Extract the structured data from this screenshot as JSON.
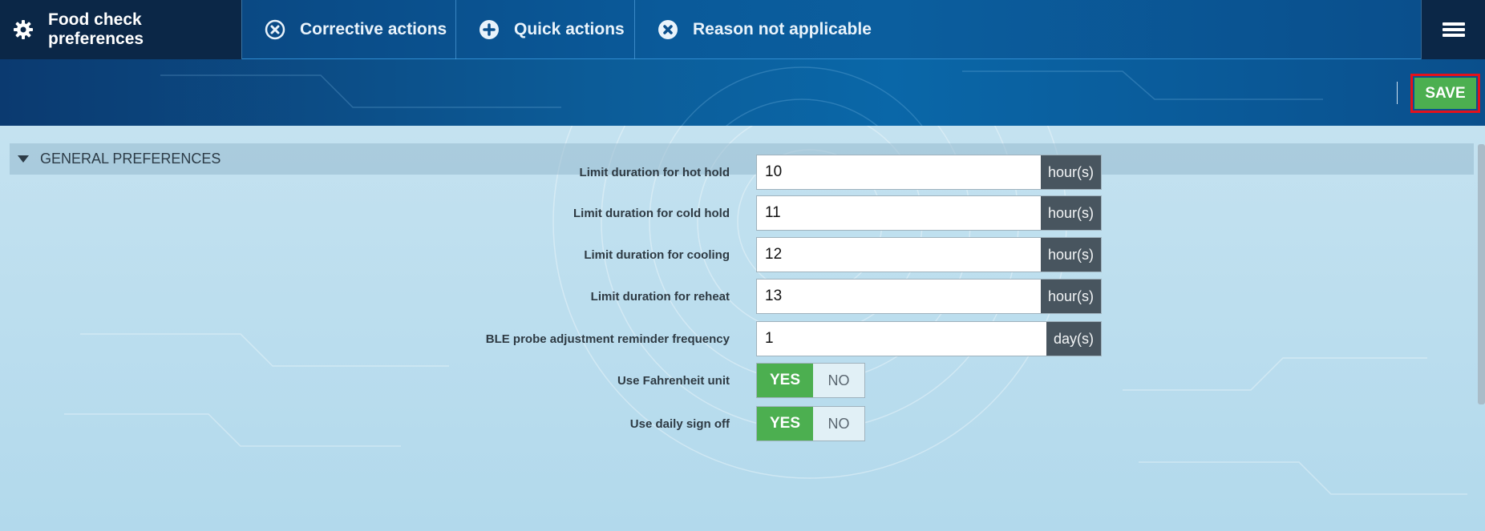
{
  "nav": {
    "tabs": [
      {
        "label": "Food check preferences",
        "icon": "gear-icon",
        "active": true
      },
      {
        "label": "Corrective actions",
        "icon": "circle-x-icon",
        "active": false
      },
      {
        "label": "Quick actions",
        "icon": "circle-plus-icon",
        "active": false
      },
      {
        "label": "Reason not applicable",
        "icon": "circle-x-filled-icon",
        "active": false
      }
    ],
    "menu_icon": "hamburger-menu-icon"
  },
  "toolbar": {
    "save_label": "SAVE"
  },
  "section": {
    "title": "GENERAL PREFERENCES",
    "fields": [
      {
        "label": "Limit duration for hot hold",
        "value": "10",
        "unit": "hour(s)"
      },
      {
        "label": "Limit duration for cold hold",
        "value": "11",
        "unit": "hour(s)"
      },
      {
        "label": "Limit duration for cooling",
        "value": "12",
        "unit": "hour(s)"
      },
      {
        "label": "Limit duration for reheat",
        "value": "13",
        "unit": "hour(s)"
      },
      {
        "label": "BLE probe adjustment reminder frequency",
        "value": "1",
        "unit": "day(s)"
      }
    ],
    "toggles": [
      {
        "label": "Use Fahrenheit unit",
        "yes": "YES",
        "no": "NO",
        "selected": "YES"
      },
      {
        "label": "Use daily sign off",
        "yes": "YES",
        "no": "NO",
        "selected": "YES"
      }
    ]
  },
  "colors": {
    "accent_green": "#4caf50",
    "save_highlight": "#e4111b",
    "nav_dark": "#0b2747",
    "unit_bg": "#48555f"
  }
}
